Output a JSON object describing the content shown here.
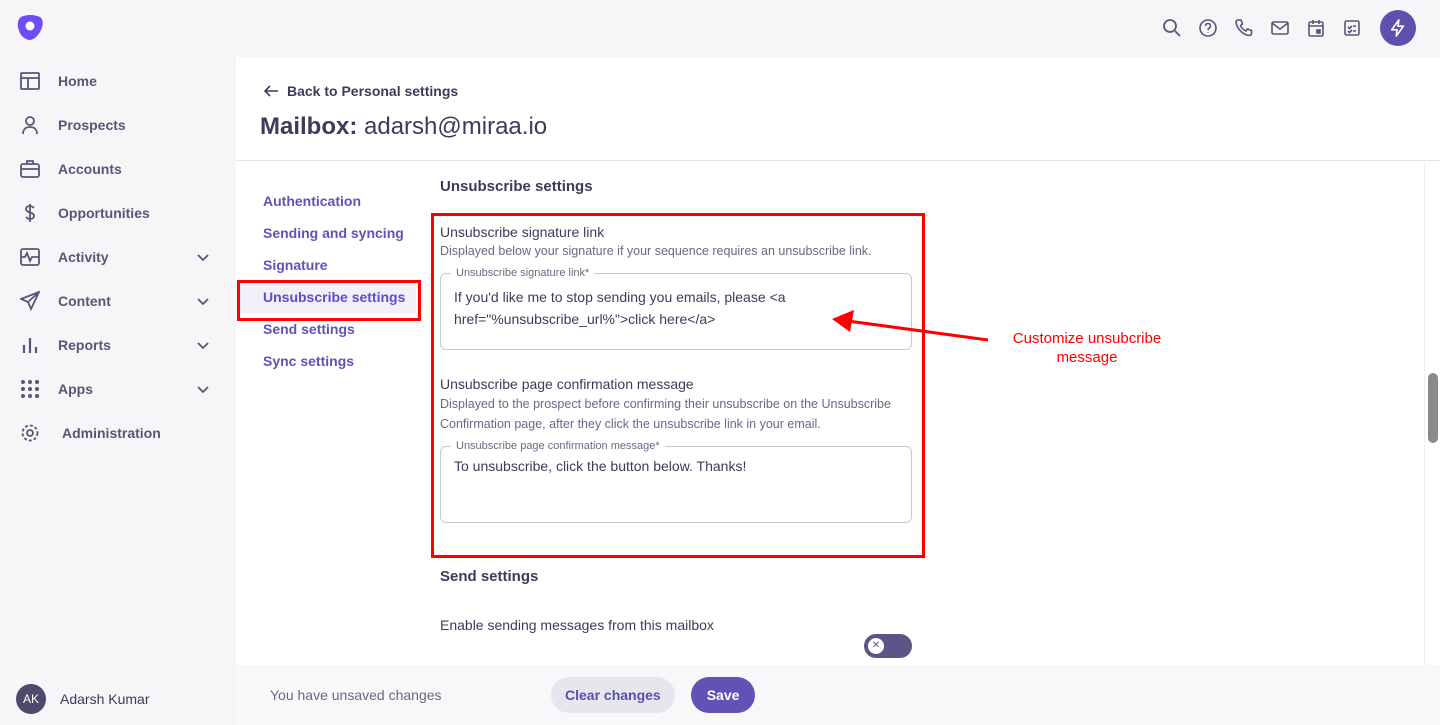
{
  "brand_color": "#6b4cf6",
  "accent_color": "#6152b8",
  "highlight_color": "#ff0000",
  "sidebar": {
    "items": [
      {
        "label": "Home",
        "icon": "layout-icon"
      },
      {
        "label": "Prospects",
        "icon": "person-icon"
      },
      {
        "label": "Accounts",
        "icon": "briefcase-icon"
      },
      {
        "label": "Opportunities",
        "icon": "dollar-icon"
      },
      {
        "label": "Activity",
        "icon": "activity-icon",
        "expandable": true
      },
      {
        "label": "Content",
        "icon": "send-icon",
        "expandable": true
      },
      {
        "label": "Reports",
        "icon": "bar-chart-icon",
        "expandable": true
      },
      {
        "label": "Apps",
        "icon": "grid-icon",
        "expandable": true
      },
      {
        "label": "Administration",
        "icon": "gear-icon"
      }
    ],
    "user": {
      "initials": "AK",
      "name": "Adarsh Kumar"
    }
  },
  "topbar": {
    "icons": [
      "search-icon",
      "help-icon",
      "phone-icon",
      "mail-icon",
      "calendar-icon",
      "tasks-icon",
      "bolt-icon"
    ]
  },
  "header": {
    "back_label": "Back to Personal settings",
    "title_prefix": "Mailbox:",
    "title_email": "adarsh@miraa.io"
  },
  "subnav": [
    {
      "label": "Authentication"
    },
    {
      "label": "Sending and syncing"
    },
    {
      "label": "Signature"
    },
    {
      "label": "Unsubscribe settings",
      "active": true
    },
    {
      "label": "Send settings"
    },
    {
      "label": "Sync settings"
    }
  ],
  "unsubscribe": {
    "heading": "Unsubscribe settings",
    "signature": {
      "label": "Unsubscribe signature link",
      "description": "Displayed below your signature if your sequence requires an unsubscribe link.",
      "field_label": "Unsubscribe signature link*",
      "value": "If you'd like me to stop sending you emails, please <a href=\"%unsubscribe_url%\">click here</a>"
    },
    "confirmation": {
      "label": "Unsubscribe page confirmation message",
      "description": "Displayed to the prospect before confirming their unsubscribe on the Unsubscribe Confirmation page, after they click the unsubscribe link in your email.",
      "field_label": "Unsubscribe page confirmation message*",
      "value": "To unsubscribe, click the button below. Thanks!"
    }
  },
  "send_settings": {
    "heading": "Send settings",
    "enable_label": "Enable sending messages from this mailbox",
    "enabled": false
  },
  "footer": {
    "unsaved": "You have unsaved changes",
    "clear_label": "Clear changes",
    "save_label": "Save"
  },
  "annotation": {
    "text": "Customize unsubcribe message"
  }
}
